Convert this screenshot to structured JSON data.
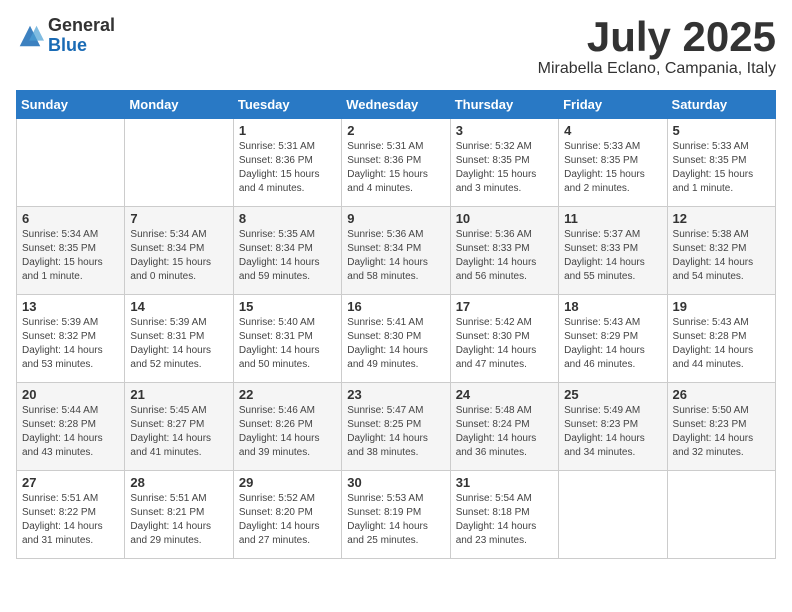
{
  "logo": {
    "general": "General",
    "blue": "Blue"
  },
  "header": {
    "month": "July 2025",
    "location": "Mirabella Eclano, Campania, Italy"
  },
  "weekdays": [
    "Sunday",
    "Monday",
    "Tuesday",
    "Wednesday",
    "Thursday",
    "Friday",
    "Saturday"
  ],
  "weeks": [
    [
      {
        "day": "",
        "content": ""
      },
      {
        "day": "",
        "content": ""
      },
      {
        "day": "1",
        "content": "Sunrise: 5:31 AM\nSunset: 8:36 PM\nDaylight: 15 hours\nand 4 minutes."
      },
      {
        "day": "2",
        "content": "Sunrise: 5:31 AM\nSunset: 8:36 PM\nDaylight: 15 hours\nand 4 minutes."
      },
      {
        "day": "3",
        "content": "Sunrise: 5:32 AM\nSunset: 8:35 PM\nDaylight: 15 hours\nand 3 minutes."
      },
      {
        "day": "4",
        "content": "Sunrise: 5:33 AM\nSunset: 8:35 PM\nDaylight: 15 hours\nand 2 minutes."
      },
      {
        "day": "5",
        "content": "Sunrise: 5:33 AM\nSunset: 8:35 PM\nDaylight: 15 hours\nand 1 minute."
      }
    ],
    [
      {
        "day": "6",
        "content": "Sunrise: 5:34 AM\nSunset: 8:35 PM\nDaylight: 15 hours\nand 1 minute."
      },
      {
        "day": "7",
        "content": "Sunrise: 5:34 AM\nSunset: 8:34 PM\nDaylight: 15 hours\nand 0 minutes."
      },
      {
        "day": "8",
        "content": "Sunrise: 5:35 AM\nSunset: 8:34 PM\nDaylight: 14 hours\nand 59 minutes."
      },
      {
        "day": "9",
        "content": "Sunrise: 5:36 AM\nSunset: 8:34 PM\nDaylight: 14 hours\nand 58 minutes."
      },
      {
        "day": "10",
        "content": "Sunrise: 5:36 AM\nSunset: 8:33 PM\nDaylight: 14 hours\nand 56 minutes."
      },
      {
        "day": "11",
        "content": "Sunrise: 5:37 AM\nSunset: 8:33 PM\nDaylight: 14 hours\nand 55 minutes."
      },
      {
        "day": "12",
        "content": "Sunrise: 5:38 AM\nSunset: 8:32 PM\nDaylight: 14 hours\nand 54 minutes."
      }
    ],
    [
      {
        "day": "13",
        "content": "Sunrise: 5:39 AM\nSunset: 8:32 PM\nDaylight: 14 hours\nand 53 minutes."
      },
      {
        "day": "14",
        "content": "Sunrise: 5:39 AM\nSunset: 8:31 PM\nDaylight: 14 hours\nand 52 minutes."
      },
      {
        "day": "15",
        "content": "Sunrise: 5:40 AM\nSunset: 8:31 PM\nDaylight: 14 hours\nand 50 minutes."
      },
      {
        "day": "16",
        "content": "Sunrise: 5:41 AM\nSunset: 8:30 PM\nDaylight: 14 hours\nand 49 minutes."
      },
      {
        "day": "17",
        "content": "Sunrise: 5:42 AM\nSunset: 8:30 PM\nDaylight: 14 hours\nand 47 minutes."
      },
      {
        "day": "18",
        "content": "Sunrise: 5:43 AM\nSunset: 8:29 PM\nDaylight: 14 hours\nand 46 minutes."
      },
      {
        "day": "19",
        "content": "Sunrise: 5:43 AM\nSunset: 8:28 PM\nDaylight: 14 hours\nand 44 minutes."
      }
    ],
    [
      {
        "day": "20",
        "content": "Sunrise: 5:44 AM\nSunset: 8:28 PM\nDaylight: 14 hours\nand 43 minutes."
      },
      {
        "day": "21",
        "content": "Sunrise: 5:45 AM\nSunset: 8:27 PM\nDaylight: 14 hours\nand 41 minutes."
      },
      {
        "day": "22",
        "content": "Sunrise: 5:46 AM\nSunset: 8:26 PM\nDaylight: 14 hours\nand 39 minutes."
      },
      {
        "day": "23",
        "content": "Sunrise: 5:47 AM\nSunset: 8:25 PM\nDaylight: 14 hours\nand 38 minutes."
      },
      {
        "day": "24",
        "content": "Sunrise: 5:48 AM\nSunset: 8:24 PM\nDaylight: 14 hours\nand 36 minutes."
      },
      {
        "day": "25",
        "content": "Sunrise: 5:49 AM\nSunset: 8:23 PM\nDaylight: 14 hours\nand 34 minutes."
      },
      {
        "day": "26",
        "content": "Sunrise: 5:50 AM\nSunset: 8:23 PM\nDaylight: 14 hours\nand 32 minutes."
      }
    ],
    [
      {
        "day": "27",
        "content": "Sunrise: 5:51 AM\nSunset: 8:22 PM\nDaylight: 14 hours\nand 31 minutes."
      },
      {
        "day": "28",
        "content": "Sunrise: 5:51 AM\nSunset: 8:21 PM\nDaylight: 14 hours\nand 29 minutes."
      },
      {
        "day": "29",
        "content": "Sunrise: 5:52 AM\nSunset: 8:20 PM\nDaylight: 14 hours\nand 27 minutes."
      },
      {
        "day": "30",
        "content": "Sunrise: 5:53 AM\nSunset: 8:19 PM\nDaylight: 14 hours\nand 25 minutes."
      },
      {
        "day": "31",
        "content": "Sunrise: 5:54 AM\nSunset: 8:18 PM\nDaylight: 14 hours\nand 23 minutes."
      },
      {
        "day": "",
        "content": ""
      },
      {
        "day": "",
        "content": ""
      }
    ]
  ]
}
